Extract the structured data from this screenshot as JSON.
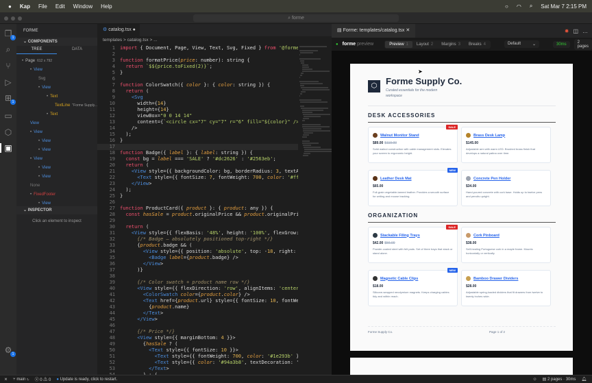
{
  "menubar": {
    "app": "Kap",
    "items": [
      "File",
      "Edit",
      "Window",
      "Help"
    ],
    "clock": "Sat Mar 7  2:15 PM"
  },
  "titlebar": {
    "search": "forme"
  },
  "activity": {
    "explorer_badge": "1",
    "extensions_badge": "1",
    "settings_badge": "1"
  },
  "sidebar": {
    "title": "FORME",
    "components": "COMPONENTS",
    "tab_tree": "TREE",
    "tab_data": "DATA",
    "inspector": "INSPECTOR",
    "inspector_hint": "Click an element to inspect",
    "tree": [
      {
        "label": "Page",
        "extra": "612 x 792",
        "indent": 0,
        "color": "#bbbbbb",
        "dot": true
      },
      {
        "label": "View",
        "indent": 1,
        "color": "#4d8fe0",
        "dot": true
      },
      {
        "label": "Svg",
        "indent": 2,
        "color": "#888888",
        "dot": false
      },
      {
        "label": "View",
        "indent": 2,
        "color": "#4d8fe0",
        "dot": true
      },
      {
        "label": "Text",
        "indent": 3,
        "color": "#d9a520",
        "dot": true
      },
      {
        "label": "TextLine",
        "extra": "\"Forme Supply...",
        "indent": 4,
        "color": "#d9a520",
        "dot": false
      },
      {
        "label": "Text",
        "indent": 3,
        "color": "#d9a520",
        "dot": true
      },
      {
        "label": "View",
        "indent": 1,
        "color": "#4d8fe0",
        "dot": false
      },
      {
        "label": "View",
        "indent": 1,
        "color": "#4d8fe0",
        "dot": true
      },
      {
        "label": "View",
        "indent": 2,
        "color": "#4d8fe0",
        "dot": true
      },
      {
        "label": "View",
        "indent": 2,
        "color": "#4d8fe0",
        "dot": true
      },
      {
        "label": "View",
        "indent": 1,
        "color": "#4d8fe0",
        "dot": true
      },
      {
        "label": "View",
        "indent": 2,
        "color": "#4d8fe0",
        "dot": true
      },
      {
        "label": "View",
        "indent": 2,
        "color": "#4d8fe0",
        "dot": true
      },
      {
        "label": "None",
        "indent": 1,
        "color": "#777777",
        "dot": false
      },
      {
        "label": "FixedFooter",
        "indent": 1,
        "color": "#d04040",
        "dot": true
      },
      {
        "label": "View",
        "indent": 2,
        "color": "#4d8fe0",
        "dot": true
      }
    ]
  },
  "editor": {
    "tab": "catalog.tsx",
    "breadcrumb": "templates  >  catalog.tsx  >  ...",
    "lines": [
      "import { Document, Page, View, Text, Svg, Fixed } from '@formepdf/react';",
      "",
      "function formatPrice(price: number): string {",
      "  return `$${price.toFixed(2)}`;",
      "}",
      "",
      "function ColorSwatch({ color }: { color: string }) {",
      "  return (",
      "    <Svg",
      "      width={14}",
      "      height={14}",
      "      viewBox=\"0 0 14 14\"",
      "      content={`<circle cx=\"7\" cy=\"7\" r=\"6\" fill=\"${color}\" /><circle cx=",
      "    />",
      "  );",
      "}",
      "",
      "function Badge({ label }: { label: string }) {",
      "  const bg = label === 'SALE' ? '#dc2626' : '#2563eb';",
      "  return (",
      "    <View style={{ backgroundColor: bg, borderRadius: 3, textAlign: 'cen",
      "      <Text style={{ fontSize: 7, fontWeight: 700, color: '#ffffff', le",
      "    </View>",
      "  );",
      "}",
      "",
      "function ProductCard({ product }: { product: any }) {",
      "  const hasSale = product.originalPrice && product.originalPrice > produ",
      "",
      "  return (",
      "    <View style={{ flexBasis: '48%', height: '100%', flexGrow: 0, flexSh",
      "      {/* Badge — absolutely positioned top-right */}",
      "      {product.badge && (",
      "        <View style={{ position: 'absolute', top: -18, right: -18 }}>",
      "          <Badge label={product.badge} />",
      "        </View>",
      "      )}",
      "",
      "      {/* Color swatch + product name row */}",
      "      <View style={{ flexDirection: 'row', alignItems: 'center', gap: 6,",
      "        <ColorSwatch color={product.color} />",
      "        <Text href={product.url} style={{ fontSize: 10, fontWeight: 700,",
      "          {product.name}",
      "        </Text>",
      "      </View>",
      "",
      "      {/* Price */}",
      "      <View style={{ marginBottom: 4 }}>",
      "        {hasSale ? (",
      "          <Text style={{ fontSize: 10 }}>",
      "            <Text style={{ fontWeight: 700, color: '#1e293b' }}>{forma",
      "            <Text style={{ color: '#94a3b8', textDecoration: 'line-thre",
      "          </Text>",
      "        ) : ("
    ],
    "current_line": 17
  },
  "preview": {
    "tab": "Forme: templates/catalog.tsx",
    "brand": "forme",
    "brand2": "preview",
    "modes": [
      {
        "label": "Preview",
        "key": "1"
      },
      {
        "label": "Layout",
        "key": "2"
      },
      {
        "label": "Margins",
        "key": "3"
      },
      {
        "label": "Breaks",
        "key": "4"
      }
    ],
    "preset": "Default",
    "time": "30ms",
    "pages": "2 pages",
    "doc": {
      "title": "Forme Supply Co.",
      "subtitle": "Curated essentials for the modern workspace",
      "footer_left": "Forme Supply Co.",
      "footer_right": "Page 1 of 2",
      "sections": [
        {
          "title": "DESK ACCESSORIES",
          "products": [
            {
              "name": "Walnut Monitor Stand",
              "price": "$89.00",
              "orig": "$119.00",
              "color": "#6b3f1f",
              "badge": "SALE",
              "desc": "Solid walnut construction with cable management slots. Elevates your screen to ergonomic height."
            },
            {
              "name": "Brass Desk Lamp",
              "price": "$145.00",
              "color": "#b5832a",
              "desc": "Adjustable arm with warm LED. Brushed brass finish that develops a natural patina over time."
            },
            {
              "name": "Leather Desk Mat",
              "price": "$65.00",
              "color": "#5a3318",
              "badge": "NEW",
              "desc": "Full-grain vegetable-tanned leather. Provides a smooth surface for writing and mouse tracking."
            },
            {
              "name": "Concrete Pen Holder",
              "price": "$34.00",
              "color": "#9ca3af",
              "desc": "Hand-poured concrete with cork base. Holds up to twelve pens and pencils upright."
            }
          ]
        },
        {
          "title": "ORGANIZATION",
          "products": [
            {
              "name": "Stackable Filing Trays",
              "price": "$42.00",
              "orig": "$56.00",
              "color": "#2d3a45",
              "badge": "SALE",
              "desc": "Powder-coated steel with felt pads. Set of three trays that stack or stand alone."
            },
            {
              "name": "Cork Pinboard",
              "price": "$38.00",
              "color": "#c89a6a",
              "desc": "Self-healing Portuguese cork in a maple frame. Mounts horizontally or vertically."
            },
            {
              "name": "Magnetic Cable Clips",
              "price": "$18.00",
              "color": "#333333",
              "badge": "NEW",
              "desc": "Silicone-wrapped neodymium magnets. Keeps charging cables tidy and within reach."
            },
            {
              "name": "Bamboo Drawer Dividers",
              "price": "$28.00",
              "color": "#c8a050",
              "desc": "Adjustable spring-loaded dividers that fit drawers from twelve to twenty inches wide."
            }
          ]
        }
      ]
    }
  },
  "status": {
    "branch": "main",
    "errors": "0",
    "warnings": "0",
    "message": "Update is ready, click to restart.",
    "right": "2 pages · 30ms"
  },
  "colors": {
    "sale": "#dc2626",
    "new": "#2563eb"
  }
}
